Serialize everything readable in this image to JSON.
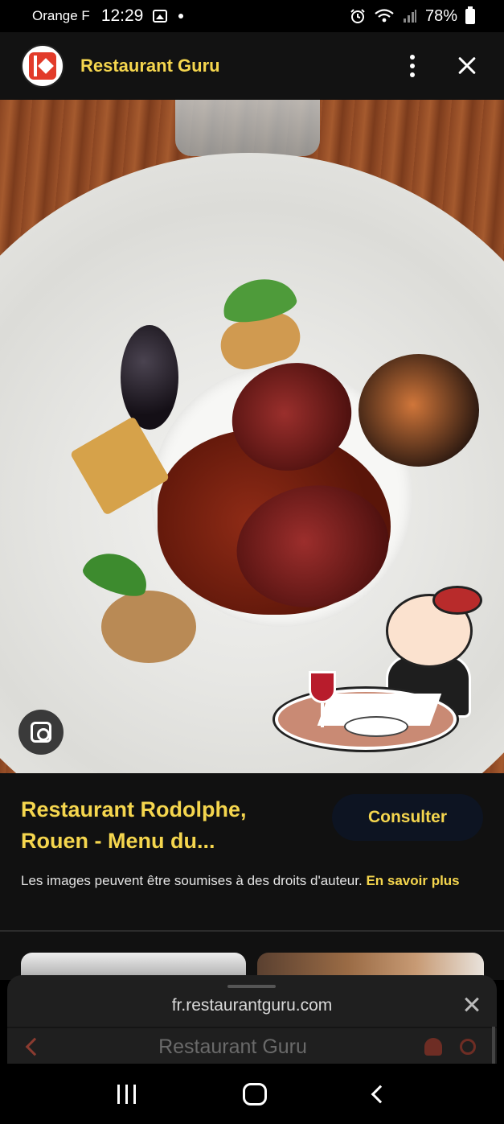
{
  "status_bar": {
    "carrier": "Orange F",
    "time": "12:29",
    "battery": "78%",
    "icons": [
      "image-icon",
      "alarm-icon",
      "wifi-icon",
      "signal-icon",
      "battery-icon"
    ]
  },
  "header": {
    "title": "Restaurant Guru",
    "logo": "restaurant-guru-logo",
    "menu_icon": "more-vert-icon",
    "close_icon": "close-icon"
  },
  "image": {
    "description_icon": "lens-icon"
  },
  "result": {
    "title": "Restaurant Rodolphe, Rouen - Menu du...",
    "visit_label": "Consulter",
    "copyright_text": "Les images peuvent être soumises à des droits d'auteur. ",
    "learn_more": "En savoir plus"
  },
  "sheet": {
    "url": "fr.restaurantguru.com",
    "site_name": "Restaurant Guru"
  },
  "colors": {
    "accent": "#f5d64e",
    "background": "#111111",
    "button_bg": "#0d1422"
  }
}
